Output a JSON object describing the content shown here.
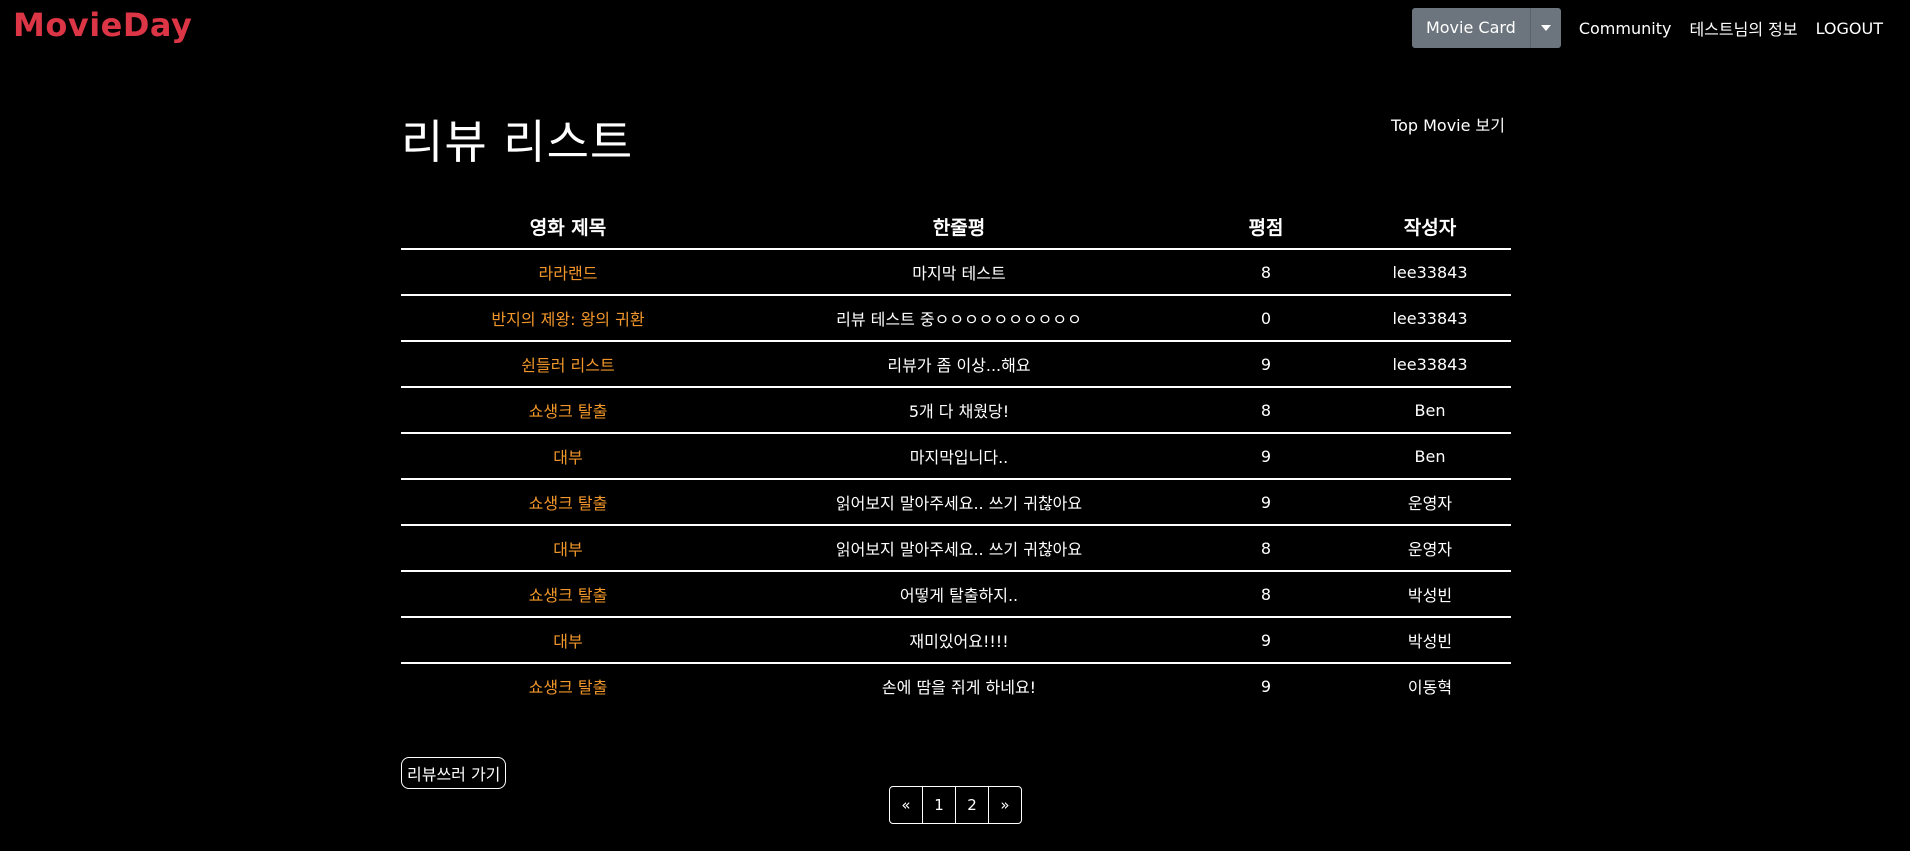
{
  "brand": "MovieDay",
  "nav": {
    "movie_card": "Movie Card",
    "community": "Community",
    "profile": "테스트님의 정보",
    "logout": "LOGOUT"
  },
  "page": {
    "title": "리뷰 리스트",
    "top_movie_link": "Top Movie 보기",
    "write_button": "리뷰쓰러 가기"
  },
  "table": {
    "headers": [
      "영화 제목",
      "한줄평",
      "평점",
      "작성자"
    ],
    "rows": [
      {
        "movie": "라라랜드",
        "comment": "마지막 테스트",
        "score": "8",
        "author": "lee33843"
      },
      {
        "movie": "반지의 제왕: 왕의 귀환",
        "comment": "리뷰 테스트 중ㅇㅇㅇㅇㅇㅇㅇㅇㅇㅇ",
        "score": "0",
        "author": "lee33843"
      },
      {
        "movie": "쉰들러 리스트",
        "comment": "리뷰가 좀 이상...해요",
        "score": "9",
        "author": "lee33843"
      },
      {
        "movie": "쇼생크 탈출",
        "comment": "5개 다 채웠당!",
        "score": "8",
        "author": "Ben"
      },
      {
        "movie": "대부",
        "comment": "마지막입니다..",
        "score": "9",
        "author": "Ben"
      },
      {
        "movie": "쇼생크 탈출",
        "comment": "읽어보지 말아주세요.. 쓰기 귀찮아요",
        "score": "9",
        "author": "운영자"
      },
      {
        "movie": "대부",
        "comment": "읽어보지 말아주세요.. 쓰기 귀찮아요",
        "score": "8",
        "author": "운영자"
      },
      {
        "movie": "쇼생크 탈출",
        "comment": "어떻게 탈출하지..",
        "score": "8",
        "author": "박성빈"
      },
      {
        "movie": "대부",
        "comment": "재미있어요!!!!",
        "score": "9",
        "author": "박성빈"
      },
      {
        "movie": "쇼생크 탈출",
        "comment": "손에 땀을 쥐게 하네요!",
        "score": "9",
        "author": "이동혁"
      }
    ]
  },
  "pagination": {
    "prev": "«",
    "pages": [
      "1",
      "2"
    ],
    "next": "»"
  },
  "colors": {
    "brand": "#dc3545",
    "movie_link": "#f0962a",
    "dropdown_button": "#6c757d",
    "background": "#000000"
  },
  "icons": {
    "dropdown": "caret-down-icon"
  }
}
